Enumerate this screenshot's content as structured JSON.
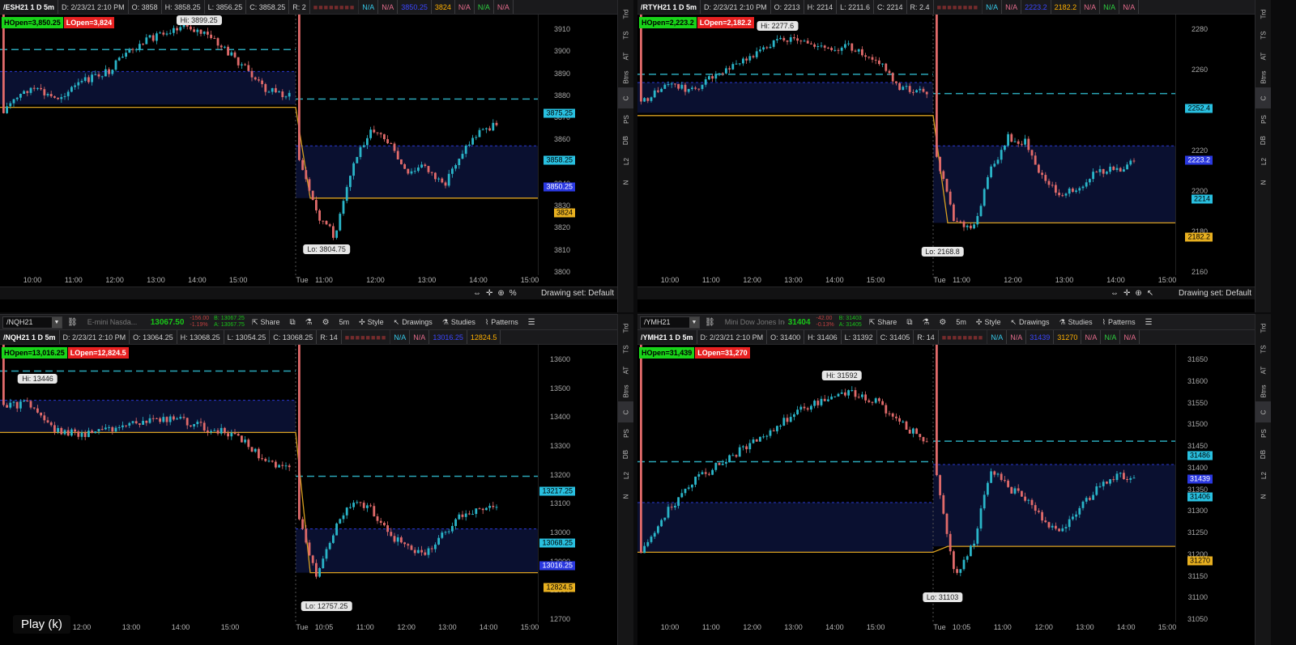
{
  "panes": [
    {
      "id": "es",
      "header": [
        "/ESH21 1 D 5m",
        "D: 2/23/21 2:10 PM",
        "O: 3858",
        "H: 3858.25",
        "L: 3856.25",
        "C: 3858.25",
        "R: 2"
      ],
      "header_tail": [
        "N/A",
        "N/A",
        "3850.25",
        "3824",
        "N/A",
        "N/A",
        "N/A"
      ],
      "hopen": "HOpen=3,850.25",
      "lopen": "LOpen=3,824",
      "hi_label": "Hi: 3899.25",
      "lo_label": "Lo: 3804.75",
      "y_ticks": [
        "3910",
        "3900",
        "3890",
        "3880",
        "3870",
        "3860",
        "3850",
        "3840",
        "3830",
        "3820",
        "3810",
        "3800"
      ],
      "x_ticks": [
        "10:00",
        "11:00",
        "12:00",
        "13:00",
        "14:00",
        "15:00",
        "Tue",
        "11:00",
        "12:00",
        "13:00",
        "14:00",
        "15:00"
      ],
      "tags": [
        {
          "text": "3875.25",
          "c": "cyan"
        },
        {
          "text": "3858.25",
          "c": "cyan"
        },
        {
          "text": "3850.25",
          "c": "blue"
        },
        {
          "text": "3824",
          "c": "yellow"
        }
      ],
      "footer": "Drawing set: Default",
      "footer_icons": [
        "⇔",
        "✛",
        "⊕",
        "%"
      ]
    },
    {
      "id": "rty",
      "header": [
        "/RTYH21 1 D 5m",
        "D: 2/23/21 2:10 PM",
        "O: 2213",
        "H: 2214",
        "L: 2211.6",
        "C: 2214",
        "R: 2.4"
      ],
      "header_tail": [
        "N/A",
        "N/A",
        "2223.2",
        "2182.2",
        "N/A",
        "N/A",
        "N/A"
      ],
      "hopen": "HOpen=2,223.2",
      "lopen": "LOpen=2,182.2",
      "hi_label": "Hi: 2277.6",
      "lo_label": "Lo: 2168.8",
      "y_ticks": [
        "2280",
        "2260",
        "2240",
        "2220",
        "2200",
        "2180",
        "2160"
      ],
      "x_ticks": [
        "10:00",
        "11:00",
        "12:00",
        "13:00",
        "14:00",
        "15:00",
        "Tue",
        "11:00",
        "12:00",
        "13:00",
        "14:00",
        "15:00"
      ],
      "tags": [
        {
          "text": "2252.4",
          "c": "cyan"
        },
        {
          "text": "2223.2",
          "c": "blue"
        },
        {
          "text": "2214",
          "c": "cyan"
        },
        {
          "text": "2182.2",
          "c": "yellow"
        }
      ],
      "footer": "Drawing set: Default",
      "footer_icons": [
        "⇔",
        "✛",
        "⊕",
        "↖"
      ]
    },
    {
      "id": "nq",
      "header": [
        "/NQH21 1 D 5m",
        "D: 2/23/21 2:10 PM",
        "O: 13064.25",
        "H: 13068.25",
        "L: 13054.25",
        "C: 13068.25",
        "R: 14"
      ],
      "header_tail": [
        "N/A",
        "N/A",
        "13016.25",
        "12824.5"
      ],
      "hopen": "HOpen=13,016.25",
      "lopen": "LOpen=12,824.5",
      "hi_label": "Hi: 13446",
      "lo_label": "Lo: 12757.25",
      "y_ticks": [
        "13600",
        "13500",
        "13400",
        "13300",
        "13200",
        "13100",
        "13000",
        "12900",
        "12800",
        "12700"
      ],
      "x_ticks": [
        "11:00",
        "12:00",
        "13:00",
        "14:00",
        "15:00",
        "Tue",
        "10:05",
        "11:00",
        "12:00",
        "13:00",
        "14:00",
        "15:00"
      ],
      "tags": [
        {
          "text": "13217.25",
          "c": "cyan"
        },
        {
          "text": "13068.25",
          "c": "cyan"
        },
        {
          "text": "13016.25",
          "c": "blue"
        },
        {
          "text": "12824.5",
          "c": "yellow"
        }
      ],
      "toolbar": {
        "symbol": "/NQH21",
        "desc": "E-mini Nasda...",
        "price": "13067.50",
        "chg": "-156.00",
        "chg_pct": "-1.19%",
        "bid": "B: 13067.25",
        "ask": "A: 13067.75",
        "share": "Share",
        "agg": "5m",
        "style": "Style",
        "drawings": "Drawings",
        "studies": "Studies",
        "patterns": "Patterns"
      }
    },
    {
      "id": "ym",
      "header": [
        "/YMH21 1 D 5m",
        "D: 2/23/21 2:10 PM",
        "O: 31400",
        "H: 31406",
        "L: 31392",
        "C: 31405",
        "R: 14"
      ],
      "header_tail": [
        "N/A",
        "N/A",
        "31439",
        "31270",
        "N/A",
        "N/A",
        "N/A"
      ],
      "hopen": "HOpen=31,439",
      "lopen": "LOpen=31,270",
      "hi_label": "Hi: 31592",
      "lo_label": "Lo: 31103",
      "y_ticks": [
        "31650",
        "31600",
        "31550",
        "31500",
        "31450",
        "31400",
        "31350",
        "31300",
        "31250",
        "31200",
        "31150",
        "31100",
        "31050"
      ],
      "x_ticks": [
        "10:00",
        "11:00",
        "12:00",
        "13:00",
        "14:00",
        "15:00",
        "Tue",
        "10:05",
        "11:00",
        "12:00",
        "13:00",
        "14:00",
        "15:00"
      ],
      "tags": [
        {
          "text": "31486",
          "c": "cyan"
        },
        {
          "text": "31439",
          "c": "blue"
        },
        {
          "text": "31406",
          "c": "cyan"
        },
        {
          "text": "31270",
          "c": "yellow"
        }
      ],
      "toolbar": {
        "symbol": "/YMH21",
        "desc": "Mini Dow Jones Ind...",
        "price": "31404",
        "chg": "-42.00",
        "chg_pct": "-0.13%",
        "bid": "B: 31403",
        "ask": "A: 31405",
        "share": "Share",
        "agg": "5m",
        "style": "Style",
        "drawings": "Drawings",
        "studies": "Studies",
        "patterns": "Patterns"
      }
    }
  ],
  "side_tabs": [
    "Trd",
    "TS",
    "AT",
    "Btns",
    "C",
    "PS",
    "DB",
    "L2",
    "N"
  ],
  "play_label": "Play (k)",
  "colors": {
    "up": "#2ab5c8",
    "down": "#e06a6a",
    "hline": "#2aa6b8",
    "blueline": "#2a38d0",
    "yellow": "#d9a020",
    "band": "#0a1030"
  }
}
